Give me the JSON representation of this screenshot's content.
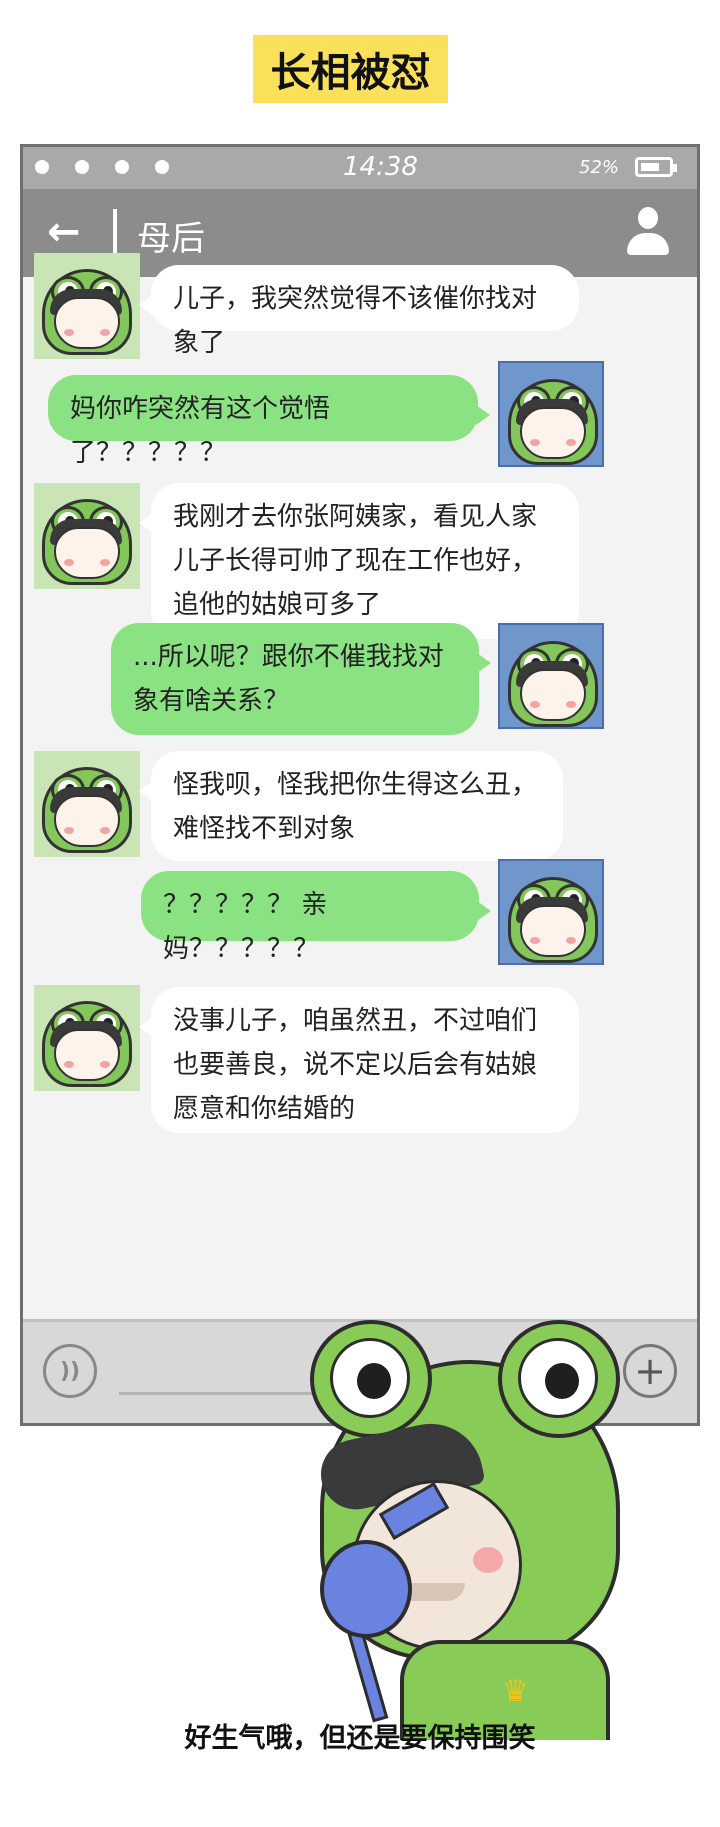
{
  "title": "长相被怼",
  "status_bar": {
    "time": "14:38",
    "battery": "52%"
  },
  "nav": {
    "back_icon": "arrow-left-icon",
    "contact_name": "母后",
    "profile_icon": "user-icon"
  },
  "messages": [
    {
      "from": "mom",
      "text": "儿子，我突然觉得不该催你找对象了"
    },
    {
      "from": "me",
      "text": "妈你咋突然有这个觉悟了？？？？？"
    },
    {
      "from": "mom",
      "text": "我刚才去你张阿姨家，看见人家儿子长得可帅了现在工作也好，追他的姑娘可多了"
    },
    {
      "from": "me",
      "text": "...所以呢？跟你不催我找对象有啥关系？"
    },
    {
      "from": "mom",
      "text": "怪我呗，怪我把你生得这么丑，难怪找不到对象"
    },
    {
      "from": "me",
      "text": "？？？？？ 亲妈？？？？？"
    },
    {
      "from": "mom",
      "text": "没事儿子，咱虽然丑，不过咱们也要善良，说不定以后会有姑娘愿意和你结婚的"
    }
  ],
  "input_bar": {
    "voice_icon": "voice-icon",
    "add_icon": "plus-icon"
  },
  "caption": "好生气哦，但还是要保持围笑"
}
